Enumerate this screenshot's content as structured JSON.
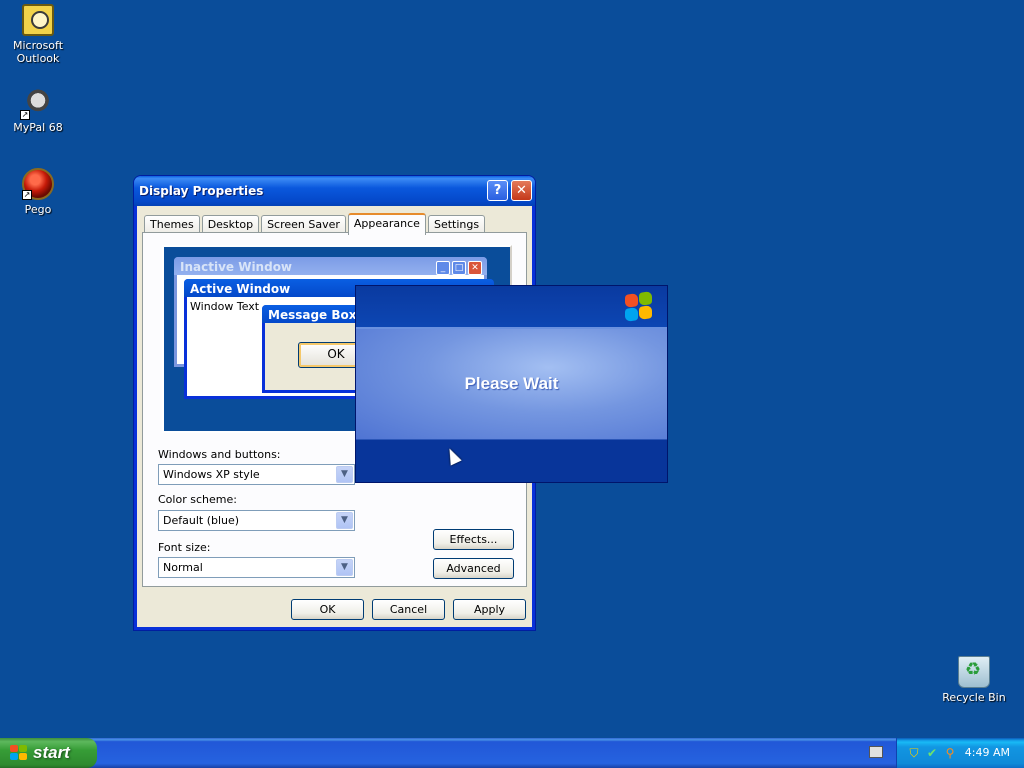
{
  "desktop": {
    "icons": [
      {
        "label_line1": "Microsoft",
        "label_line2": "Outlook",
        "icon": "outlook-icon"
      },
      {
        "label_line1": "MyPal 68",
        "icon": "mypal-icon"
      },
      {
        "label_line1": "Pego",
        "icon": "pego-icon"
      },
      {
        "label_line1": "Recycle Bin",
        "icon": "recycle-bin-icon"
      }
    ]
  },
  "window": {
    "title": "Display Properties",
    "help_glyph": "?",
    "close_glyph": "✕",
    "tabs": [
      "Themes",
      "Desktop",
      "Screen Saver",
      "Appearance",
      "Settings"
    ],
    "active_tab": "Appearance",
    "preview": {
      "inactive_title": "Inactive Window",
      "active_title": "Active Window",
      "window_text": "Window Text",
      "message_box_title": "Message Box",
      "ok_label": "OK"
    },
    "windows_buttons_label": "Windows and buttons:",
    "windows_buttons_value": "Windows XP style",
    "color_scheme_label": "Color scheme:",
    "color_scheme_value": "Default (blue)",
    "font_size_label": "Font size:",
    "font_size_value": "Normal",
    "effects_label": "Effects...",
    "advanced_label": "Advanced",
    "ok_label": "OK",
    "cancel_label": "Cancel",
    "apply_label": "Apply"
  },
  "overlay": {
    "message": "Please Wait"
  },
  "taskbar": {
    "start_label": "start",
    "clock": "4:49 AM"
  },
  "colors": {
    "desktop": "#0a4d9a",
    "title_blue": "#0448c9",
    "start_green": "#379d37"
  }
}
